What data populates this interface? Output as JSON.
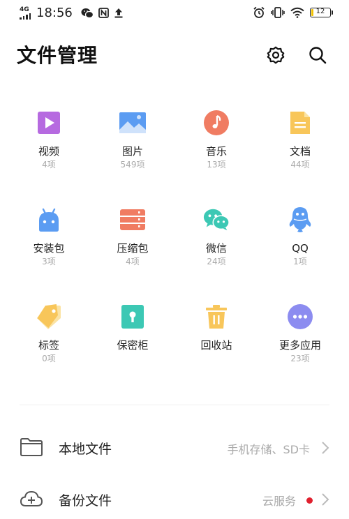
{
  "status_bar": {
    "network": "4G",
    "time": "18:56",
    "battery": "12",
    "icons": [
      "signal-icon",
      "wechat-icon",
      "nfc-icon",
      "upload-icon",
      "alarm-icon",
      "vibrate-icon",
      "wifi-icon",
      "battery-icon"
    ]
  },
  "header": {
    "title": "文件管理",
    "settings_icon": "gear-icon",
    "search_icon": "search-icon"
  },
  "categories": [
    {
      "name": "视频",
      "count": "4项",
      "icon": "video-icon",
      "color": "#b66ae0"
    },
    {
      "name": "图片",
      "count": "549项",
      "icon": "image-icon",
      "color": "#5b9cf2"
    },
    {
      "name": "音乐",
      "count": "13项",
      "icon": "music-icon",
      "color": "#f07c62"
    },
    {
      "name": "文档",
      "count": "44项",
      "icon": "document-icon",
      "color": "#f8c65a"
    },
    {
      "name": "安装包",
      "count": "3项",
      "icon": "android-icon",
      "color": "#5b9cf2"
    },
    {
      "name": "压缩包",
      "count": "4项",
      "icon": "archive-icon",
      "color": "#f07c62"
    },
    {
      "name": "微信",
      "count": "24项",
      "icon": "wechat-icon",
      "color": "#3cc8b4"
    },
    {
      "name": "QQ",
      "count": "1项",
      "icon": "qq-icon",
      "color": "#5b9cf2"
    },
    {
      "name": "标签",
      "count": "0项",
      "icon": "tag-icon",
      "color": "#f8c65a"
    },
    {
      "name": "保密柜",
      "count": "",
      "icon": "safe-icon",
      "color": "#3cc8b4"
    },
    {
      "name": "回收站",
      "count": "",
      "icon": "trash-icon",
      "color": "#f8c65a"
    },
    {
      "name": "更多应用",
      "count": "23项",
      "icon": "more-apps-icon",
      "color": "#8c8cf0"
    }
  ],
  "list": [
    {
      "label": "本地文件",
      "value": "手机存储、SD卡",
      "icon": "folder-icon"
    },
    {
      "label": "备份文件",
      "value": "云服务",
      "icon": "cloud-add-icon",
      "badge_color": "#e0202e"
    }
  ]
}
